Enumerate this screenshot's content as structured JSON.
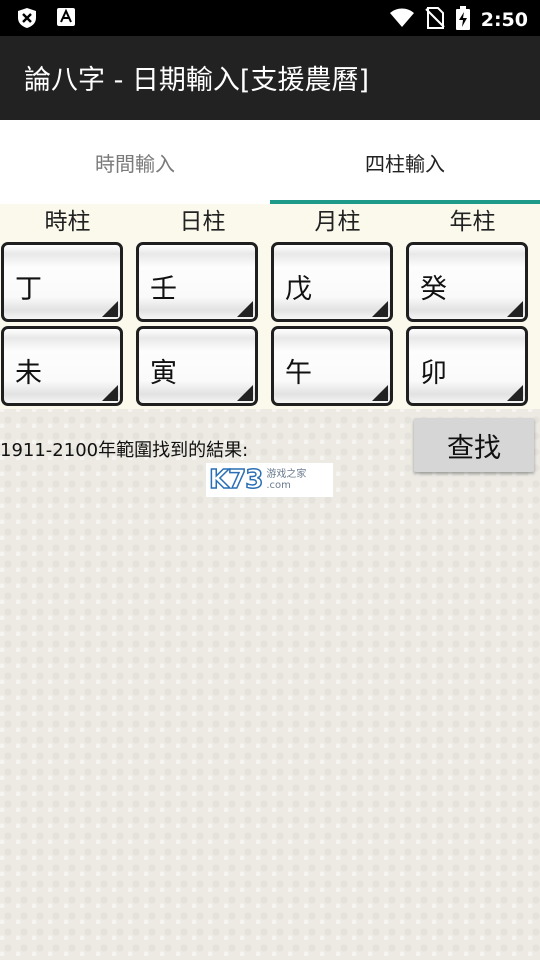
{
  "status_bar": {
    "time": "2:50",
    "icons": [
      "security-icon",
      "text-badge-icon",
      "wifi-icon",
      "no-sim-icon",
      "battery-charging-icon"
    ]
  },
  "app_bar": {
    "title": "論八字 - 日期輸入[支援農曆]"
  },
  "tabs": [
    {
      "label": "時間輸入",
      "selected": false
    },
    {
      "label": "四柱輸入",
      "selected": true
    }
  ],
  "accent_color": "#1e9a8a",
  "pillars": {
    "headers": [
      "時柱",
      "日柱",
      "月柱",
      "年柱"
    ],
    "stems": [
      "丁",
      "壬",
      "戊",
      "癸"
    ],
    "branches": [
      "未",
      "寅",
      "午",
      "卯"
    ]
  },
  "result_label": "1911-2100年範圍找到的結果:",
  "search_button": "查找",
  "watermark": {
    "logo": "K73",
    "text": "游戏之家",
    "domain": ".com"
  }
}
